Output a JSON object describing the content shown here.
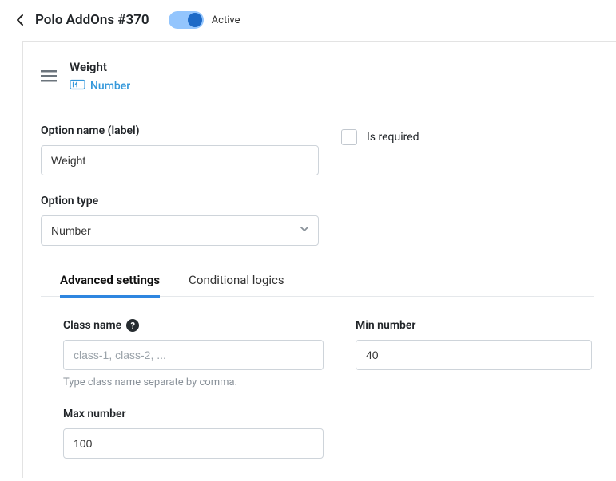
{
  "header": {
    "title": "Polo AddOns #370",
    "toggle_state_label": "Active"
  },
  "option": {
    "title": "Weight",
    "type_tag": "Number"
  },
  "labels": {
    "option_name": "Option name (label)",
    "is_required": "Is required",
    "option_type": "Option type",
    "class_name": "Class name",
    "min_number": "Min number",
    "max_number": "Max number"
  },
  "values": {
    "option_name": "Weight",
    "option_type": "Number",
    "class_name_placeholder": "class-1, class-2, ...",
    "class_name": "",
    "min_number": "40",
    "max_number": "100"
  },
  "hints": {
    "class_name": "Type class name separate by comma."
  },
  "tabs": {
    "advanced": "Advanced settings",
    "conditional": "Conditional logics"
  }
}
